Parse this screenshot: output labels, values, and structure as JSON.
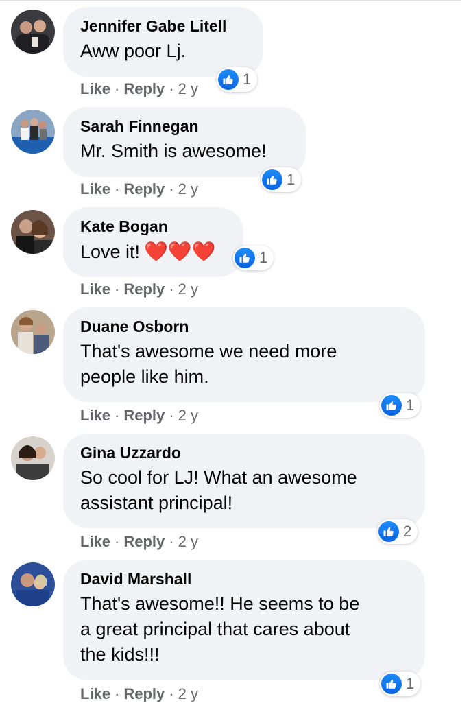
{
  "action_labels": {
    "like": "Like",
    "reply": "Reply",
    "separator": "·"
  },
  "colors": {
    "bubble": "#f0f2f5",
    "like_blue": "#1877f2",
    "meta_gray": "#65676b",
    "heart": "#e0242f"
  },
  "comments": [
    {
      "author": "Jennifer Gabe Litell",
      "lines": [
        "Aww poor Lj."
      ],
      "time": "2 y",
      "reactions": {
        "icon": "like-icon",
        "count": "1"
      }
    },
    {
      "author": "Sarah Finnegan",
      "lines": [
        "Mr. Smith is awesome!"
      ],
      "time": "2 y",
      "reactions": {
        "icon": "like-icon",
        "count": "1"
      }
    },
    {
      "author": "Kate Bogan",
      "lines": [
        "Love it!"
      ],
      "emoji": "❤️❤️❤️",
      "time": "2 y",
      "reactions": {
        "icon": "like-icon",
        "count": "1"
      }
    },
    {
      "author": "Duane Osborn",
      "lines": [
        "That's awesome we need more",
        "people like him."
      ],
      "time": "2 y",
      "reactions": {
        "icon": "like-icon",
        "count": "1"
      }
    },
    {
      "author": "Gina Uzzardo",
      "lines": [
        "So cool for LJ! What an awesome",
        "assistant principal!"
      ],
      "time": "2 y",
      "reactions": {
        "icon": "like-icon",
        "count": "2"
      }
    },
    {
      "author": "David Marshall",
      "lines": [
        "That's awesome!! He seems to be",
        "a great principal that cares about",
        "the kids!!!"
      ],
      "time": "2 y",
      "reactions": {
        "icon": "like-icon",
        "count": "1"
      }
    }
  ]
}
